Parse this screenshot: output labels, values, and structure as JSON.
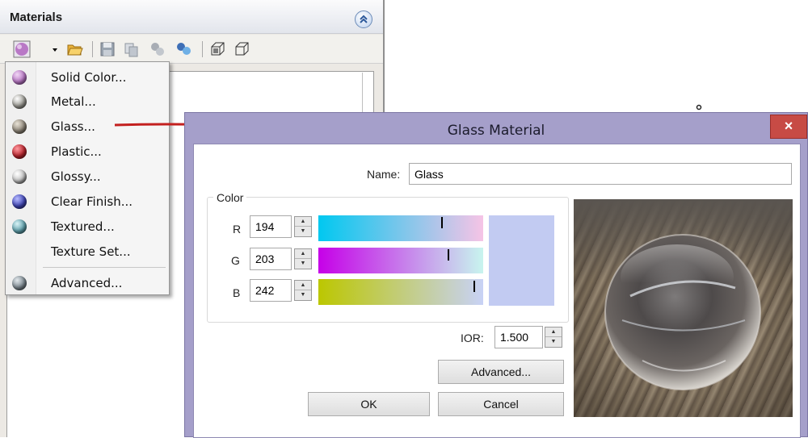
{
  "panel": {
    "title": "Materials"
  },
  "menu": {
    "items": [
      {
        "label": "Solid Color...",
        "icon": "solid-color-sphere-icon",
        "color": "#b978c6"
      },
      {
        "label": "Metal...",
        "icon": "metal-sphere-icon",
        "color": "#9b9a93"
      },
      {
        "label": "Glass...",
        "icon": "glass-sphere-icon",
        "color": "#8d8578"
      },
      {
        "label": "Plastic...",
        "icon": "plastic-sphere-icon",
        "color": "#b8242d"
      },
      {
        "label": "Glossy...",
        "icon": "glossy-sphere-icon",
        "color": "#c8c8c8"
      },
      {
        "label": "Clear Finish...",
        "icon": "clear-finish-sphere-icon",
        "color": "#3f45b4"
      },
      {
        "label": "Textured...",
        "icon": "textured-sphere-icon",
        "color": "#5fa1ad"
      },
      {
        "label": "Texture Set...",
        "icon": "",
        "color": ""
      },
      {
        "label": "Advanced...",
        "icon": "advanced-sphere-icon",
        "color": "#7c8890"
      }
    ]
  },
  "dialog": {
    "title": "Glass Material",
    "close_label": "×",
    "name_label": "Name:",
    "name_value": "Glass",
    "color_group_label": "Color",
    "r_label": "R",
    "r_value": "194",
    "g_label": "G",
    "g_value": "203",
    "b_label": "B",
    "b_value": "242",
    "ior_label": "IOR:",
    "ior_value": "1.500",
    "advanced_label": "Advanced...",
    "ok_label": "OK",
    "cancel_label": "Cancel",
    "swatch_color": "#c2cbf2"
  }
}
